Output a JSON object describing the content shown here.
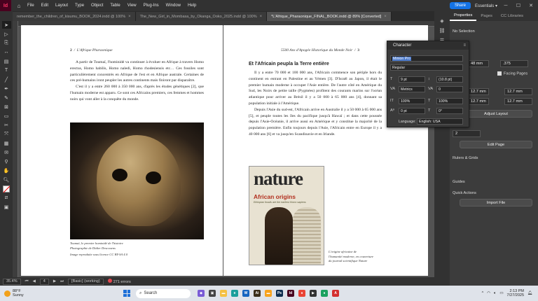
{
  "menubar": {
    "logo": "Id",
    "items": [
      "File",
      "Edit",
      "Layout",
      "Type",
      "Object",
      "Table",
      "View",
      "Plug-Ins",
      "Window",
      "Help"
    ],
    "share_label": "Share",
    "workspace": "Essentials"
  },
  "tabs": [
    {
      "label": "remember_the_children_of_kisumu_BOOK_2024.indd @ 100%",
      "active": false
    },
    {
      "label": "The_New_Girl_in_Mombasa_by_Okanga_Ooko_2025.indd @ 100%",
      "active": false
    },
    {
      "label": "*L'Afrique_Pharaonique_FINAL_BOOK.indd @ 89% [Converted]",
      "active": true
    }
  ],
  "left_page": {
    "page_number": "2",
    "running_head": "L'Afrique Pharaonique",
    "paragraphs": [
      "A partir de Toumaï, l'hominidé va continuer à évoluer en Afrique à travers Homo erectus, Homo habilis, Homo naledi, Homo rhodesiensis etc… Ces fossiles sont particulièrement concentrés en Afrique de l'est et en Afrique australe. Certaines de ces pré-humains iront peupler les autres continents mais finiront par disparaître.",
      "C'est il y a entre 260 000 à 350 000 ans, d'après les études génétiques [2], que l'humain moderne est apparu. Ce sont ces Africains premiers, ces femmes et hommes noirs qui vont aller à la conquête du monde."
    ],
    "caption": [
      "Toumaï, le premier hominidé de l'histoire",
      "Photographie de Didier Descouens",
      "Image reproduite sous licence CC BY-SA 4.0"
    ]
  },
  "right_page": {
    "page_number": "3",
    "running_head": "5500 Ans d'Apogée Historique du Monde Noir",
    "section_title": "Et l'Africain peupla la Terre entière",
    "paragraphs": [
      "Il y a entre 70 000 et 100 000 ans, l'Africain commence son périple hors du continent en entrant en Palestine et au Yémen [3]. D'Israël au Japon, il était le premier humain moderne à occuper l'Asie entière. De l'autre côté en Amérique du Sud, les Noirs de petite taille (Pygmées) profitent des courants marins sur l'océan atlantique pour arriver au Brésil il y a 50 000 à 65 000 ans [4], donnant sa population initiale à l'Amérique.",
      "Depuis l'Asie du sud-est, l'Africain arrive en Australie il y a 50 000 à 65 000 ans [5], et peuple toutes les îles du pacifique jusqu'à Hawaï ; et dans cette poussée depuis l'Asie-Océanie, il arrive aussi en Amérique et y constitue la majorité de la population première. Enfin toujours depuis l'Asie, l'Africain entre en Europe il y a 40 000 ans [6] et va jusqu'en Scandinavie et en Irlande."
    ],
    "nature_logo": "nature",
    "nature_headline": "African origins",
    "nature_sub": "Ethiopian fossils are the earliest Homo sapiens",
    "caption": [
      "L'origine africaine de",
      "l'humanité moderne, en couverture",
      "du journal scientifique Nature"
    ]
  },
  "statusbar": {
    "zoom": "35.4%",
    "page": "4",
    "style": "[Basic] (working)",
    "errors": "271 errors"
  },
  "properties_panel": {
    "tabs": [
      "Properties",
      "Pages",
      "CC Libraries"
    ],
    "no_selection": "No Selection",
    "field_48": "48 mm",
    "field_375": ".375",
    "facing_pages": "Facing Pages",
    "margin_top": "12.7 mm",
    "margin_bottom": "12.7 mm",
    "margin_left": "12.7 mm",
    "margin_right": "12.7 mm",
    "adjust_layout": "Adjust Layout",
    "page_field": "2",
    "edit_page": "Edit Page",
    "rulers_grids": "Rulers & Grids",
    "guides": "Guides",
    "quick_actions": "Quick Actions",
    "import_file": "Import File"
  },
  "character_panel": {
    "title": "Character",
    "font": "Minion Pro",
    "style": "Regular",
    "size": "9 pt",
    "leading": "(10.8 pt)",
    "kerning": "Metrics",
    "tracking": "0",
    "vscale": "100%",
    "hscale": "100%",
    "baseline": "0 pt",
    "skew": "0°",
    "language_label": "Language:",
    "language": "English: USA"
  },
  "taskbar": {
    "temp": "88°F",
    "condition": "Sunny",
    "search": "Search",
    "time": "2:13 PM",
    "date": "7/27/2025"
  }
}
